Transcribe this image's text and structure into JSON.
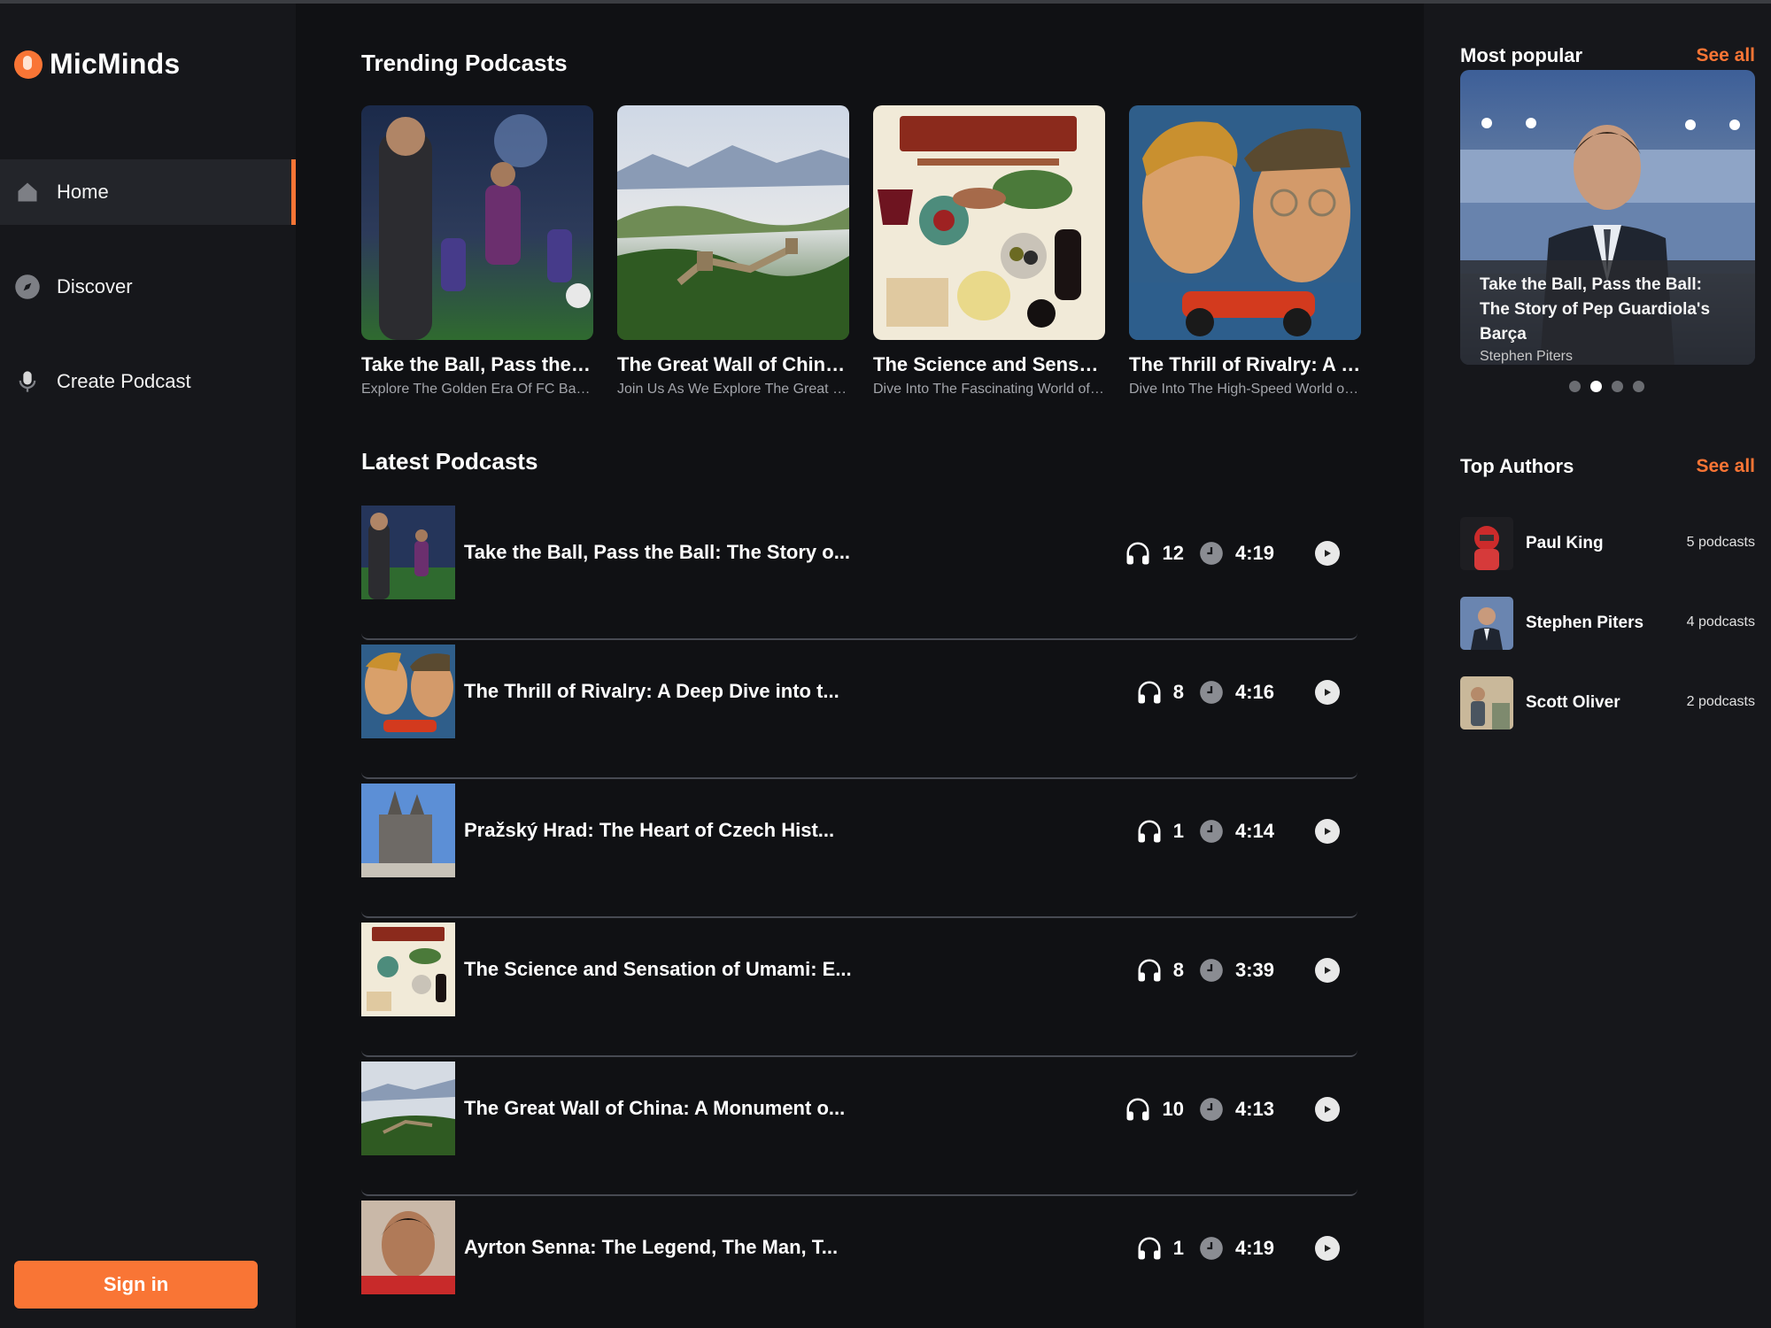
{
  "app": {
    "name": "MicMinds"
  },
  "colors": {
    "accent": "#f97535",
    "background": "#101114",
    "panel": "#16171b"
  },
  "sidebar": {
    "items": [
      {
        "label": "Home",
        "icon": "home-icon",
        "active": true
      },
      {
        "label": "Discover",
        "icon": "compass-icon",
        "active": false
      },
      {
        "label": "Create Podcast",
        "icon": "microphone-icon",
        "active": false
      }
    ],
    "signin_label": "Sign in"
  },
  "trending": {
    "title": "Trending Podcasts",
    "cards": [
      {
        "title": "Take the Ball, Pass the Ball: The Story of Pep Guardiola's Barça",
        "desc": "Explore The Golden Era Of FC Barcelona"
      },
      {
        "title": "The Great Wall of China: A Monument of History",
        "desc": "Join Us As We Explore The Great Wall of China"
      },
      {
        "title": "The Science and Sensation of Umami",
        "desc": "Dive Into The Fascinating World of Umami"
      },
      {
        "title": "The Thrill of Rivalry: A Deep Dive into the World of Racing",
        "desc": "Dive Into The High-Speed World of Racing"
      }
    ]
  },
  "latest": {
    "title": "Latest Podcasts",
    "items": [
      {
        "title": "Take the Ball, Pass the Ball: The Story o...",
        "listeners": "12",
        "duration": "4:19"
      },
      {
        "title": "The Thrill of Rivalry: A Deep Dive into t...",
        "listeners": "8",
        "duration": "4:16"
      },
      {
        "title": "Pražský Hrad: The Heart of Czech Hist...",
        "listeners": "1",
        "duration": "4:14"
      },
      {
        "title": "The Science and Sensation of Umami: E...",
        "listeners": "8",
        "duration": "3:39"
      },
      {
        "title": "The Great Wall of China: A Monument o...",
        "listeners": "10",
        "duration": "4:13"
      },
      {
        "title": "Ayrton Senna: The Legend, The Man, T...",
        "listeners": "1",
        "duration": "4:19"
      }
    ]
  },
  "popular": {
    "title": "Most popular",
    "see_all": "See all",
    "card_title": "Take the Ball, Pass the Ball: The Story of Pep Guardiola's Barça",
    "card_author": "Stephen Piters",
    "active_slide": 2,
    "slide_count": 4
  },
  "top_authors": {
    "title": "Top Authors",
    "see_all": "See all",
    "items": [
      {
        "name": "Paul King",
        "count": "5 podcasts"
      },
      {
        "name": "Stephen Piters",
        "count": "4 podcasts"
      },
      {
        "name": "Scott Oliver",
        "count": "2 podcasts"
      }
    ]
  }
}
